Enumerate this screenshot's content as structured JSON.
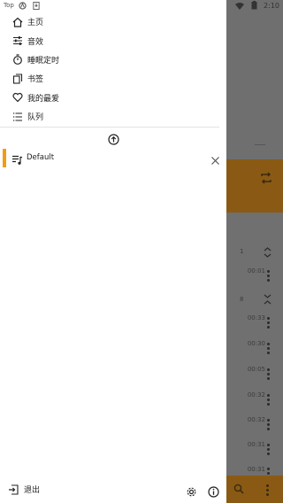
{
  "status_bar": {
    "left_text": "Top",
    "time": "2:10"
  },
  "menu": {
    "items": [
      {
        "label": "主页",
        "icon": "home-icon"
      },
      {
        "label": "音效",
        "icon": "equalizer-icon"
      },
      {
        "label": "睡眠定时",
        "icon": "timer-icon"
      },
      {
        "label": "书签",
        "icon": "bookmark-icon"
      },
      {
        "label": "我的最爱",
        "icon": "heart-icon"
      },
      {
        "label": "队列",
        "icon": "queue-icon"
      }
    ]
  },
  "playlist": {
    "name": "Default"
  },
  "footer": {
    "exit_label": "退出"
  },
  "background_app": {
    "times": [
      "00:01",
      "00:33",
      "00:30",
      "00:05",
      "00:32",
      "00:32",
      "00:31",
      "00:31"
    ],
    "row_labels": [
      "1",
      "8"
    ]
  },
  "colors": {
    "accent": "#f39c12",
    "overlay": "#707070",
    "orange_dim": "#8a5a14"
  }
}
